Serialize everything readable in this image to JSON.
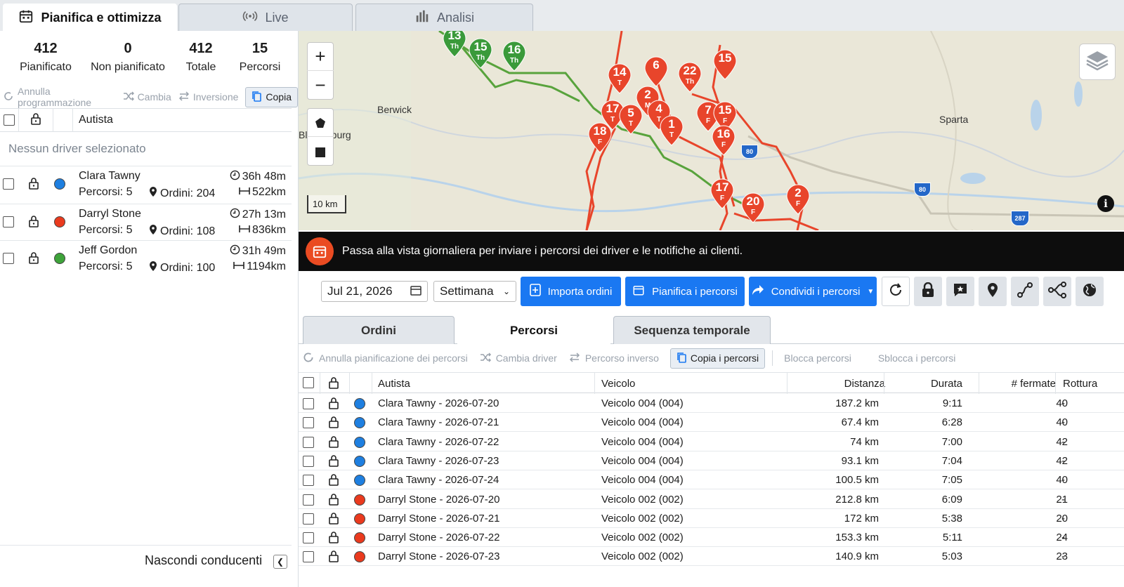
{
  "top_tabs": [
    {
      "label": "Pianifica e ottimizza",
      "icon": "calendar-icon"
    },
    {
      "label": "Live",
      "icon": "broadcast-icon"
    },
    {
      "label": "Analisi",
      "icon": "bar-chart-icon"
    }
  ],
  "stats": [
    {
      "value": "412",
      "label": "Pianificato"
    },
    {
      "value": "0",
      "label": "Non pianificato"
    },
    {
      "value": "412",
      "label": "Totale"
    },
    {
      "value": "15",
      "label": "Percorsi"
    }
  ],
  "left_actions": {
    "unschedule": "Annulla programmazione",
    "swap": "Cambia",
    "reverse": "Inversione",
    "copy": "Copia"
  },
  "driver_header": "Autista",
  "no_driver_text": "Nessun driver selezionato",
  "drivers": [
    {
      "name": "Clara Tawny",
      "routes": "Percorsi: 5",
      "orders": "Ordini: 204",
      "time": "36h 48m",
      "distance": "522km",
      "color": "#1e7fe0"
    },
    {
      "name": "Darryl Stone",
      "routes": "Percorsi: 5",
      "orders": "Ordini: 108",
      "time": "27h 13m",
      "distance": "836km",
      "color": "#ea3a1e"
    },
    {
      "name": "Jeff Gordon",
      "routes": "Percorsi: 5",
      "orders": "Ordini: 100",
      "time": "31h 49m",
      "distance": "1194km",
      "color": "#3ea33a"
    }
  ],
  "hide_drivers_label": "Nascondi conducenti",
  "map": {
    "scale_label": "10 km",
    "places": [
      "Berwick",
      "Bloomsburg",
      "Sparta"
    ],
    "highways": [
      "80",
      "80",
      "287"
    ],
    "pins": [
      {
        "n": "13",
        "s": "Th",
        "c": "#3a9a3a"
      },
      {
        "n": "15",
        "s": "Th",
        "c": "#3a9a3a"
      },
      {
        "n": "16",
        "s": "Th",
        "c": "#3a9a3a"
      },
      {
        "n": "14",
        "s": "T",
        "c": "#e8452b"
      },
      {
        "n": "6",
        "s": "",
        "c": "#e8452b"
      },
      {
        "n": "22",
        "s": "Th",
        "c": "#e8452b"
      },
      {
        "n": "15",
        "s": "",
        "c": "#e8452b"
      },
      {
        "n": "2",
        "s": "M",
        "c": "#e8452b"
      },
      {
        "n": "17",
        "s": "T",
        "c": "#e8452b"
      },
      {
        "n": "5",
        "s": "T",
        "c": "#e8452b"
      },
      {
        "n": "4",
        "s": "T",
        "c": "#e8452b"
      },
      {
        "n": "1",
        "s": "T",
        "c": "#e8452b"
      },
      {
        "n": "7",
        "s": "F",
        "c": "#e8452b"
      },
      {
        "n": "15",
        "s": "F",
        "c": "#e8452b"
      },
      {
        "n": "16",
        "s": "F",
        "c": "#e8452b"
      },
      {
        "n": "18",
        "s": "F",
        "c": "#e8452b"
      },
      {
        "n": "17",
        "s": "F",
        "c": "#e8452b"
      },
      {
        "n": "20",
        "s": "F",
        "c": "#e8452b"
      },
      {
        "n": "2",
        "s": "F",
        "c": "#e8452b"
      }
    ]
  },
  "banner_text": "Passa alla vista giornaliera per inviare i percorsi dei driver e le notifiche ai clienti.",
  "toolbar": {
    "date": "Jul 21, 2026",
    "period": "Settimana",
    "import_label": "Importa ordini",
    "plan_label": "Pianifica i percorsi",
    "share_label": "Condividi i percorsi"
  },
  "sub_tabs": [
    "Ordini",
    "Percorsi",
    "Sequenza temporale"
  ],
  "route_actions": {
    "unschedule": "Annulla pianificazione dei percorsi",
    "change_driver": "Cambia driver",
    "reverse": "Percorso inverso",
    "copy": "Copia i percorsi",
    "lock": "Blocca percorsi",
    "unlock": "Sblocca i percorsi"
  },
  "table": {
    "headers": {
      "driver": "Autista",
      "vehicle": "Veicolo",
      "distance": "Distanza",
      "duration": "Durata",
      "stops": "# fermate",
      "break": "Rottura"
    },
    "rows": [
      {
        "driver": "Clara Tawny - 2026-07-20",
        "vehicle": "Veicolo 004 (004)",
        "distance": "187.2 km",
        "duration": "9:11",
        "stops": "40",
        "break": "-",
        "color": "#1e7fe0"
      },
      {
        "driver": "Clara Tawny - 2026-07-21",
        "vehicle": "Veicolo 004 (004)",
        "distance": "67.4 km",
        "duration": "6:28",
        "stops": "40",
        "break": "-",
        "color": "#1e7fe0"
      },
      {
        "driver": "Clara Tawny - 2026-07-22",
        "vehicle": "Veicolo 004 (004)",
        "distance": "74 km",
        "duration": "7:00",
        "stops": "42",
        "break": "-",
        "color": "#1e7fe0"
      },
      {
        "driver": "Clara Tawny - 2026-07-23",
        "vehicle": "Veicolo 004 (004)",
        "distance": "93.1 km",
        "duration": "7:04",
        "stops": "42",
        "break": "-",
        "color": "#1e7fe0"
      },
      {
        "driver": "Clara Tawny - 2026-07-24",
        "vehicle": "Veicolo 004 (004)",
        "distance": "100.5 km",
        "duration": "7:05",
        "stops": "40",
        "break": "-",
        "color": "#1e7fe0"
      },
      {
        "driver": "Darryl Stone - 2026-07-20",
        "vehicle": "Veicolo 002 (002)",
        "distance": "212.8 km",
        "duration": "6:09",
        "stops": "21",
        "break": "-",
        "color": "#ea3a1e"
      },
      {
        "driver": "Darryl Stone - 2026-07-21",
        "vehicle": "Veicolo 002 (002)",
        "distance": "172 km",
        "duration": "5:38",
        "stops": "20",
        "break": "-",
        "color": "#ea3a1e"
      },
      {
        "driver": "Darryl Stone - 2026-07-22",
        "vehicle": "Veicolo 002 (002)",
        "distance": "153.3 km",
        "duration": "5:11",
        "stops": "24",
        "break": "-",
        "color": "#ea3a1e"
      },
      {
        "driver": "Darryl Stone - 2026-07-23",
        "vehicle": "Veicolo 002 (002)",
        "distance": "140.9 km",
        "duration": "5:03",
        "stops": "23",
        "break": "-",
        "color": "#ea3a1e"
      }
    ]
  }
}
